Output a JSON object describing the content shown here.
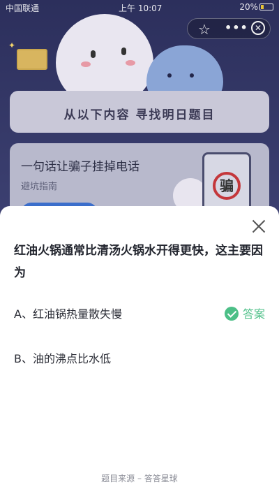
{
  "status_bar": {
    "carrier": "中国联通",
    "wifi_icon": "wifi-icon",
    "time": "上午 10:07",
    "battery": "20%"
  },
  "miniprogram": {
    "star_icon": "star-icon",
    "more_icon": "more-dots-icon",
    "close_icon": "close-circle-icon"
  },
  "background_page": {
    "section_title": "从以下内容 寻找明日题目",
    "card_headline": "一句话让骗子挂掉电话",
    "card_subtitle": "避坑指南",
    "phone_sign_char": "骗"
  },
  "sheet": {
    "question": "红油火锅通常比清汤火锅水开得更快，这主要因为",
    "options": [
      {
        "label": "A、红油锅热量散失慢",
        "is_answer": true
      },
      {
        "label": "B、油的沸点比水低",
        "is_answer": false
      }
    ],
    "answer_label": "答案",
    "source": "题目来源 – 答答星球"
  },
  "colors": {
    "accent_green": "#4cbf87",
    "sheet_bg": "#ffffff",
    "backdrop": "#3a3d6e"
  }
}
